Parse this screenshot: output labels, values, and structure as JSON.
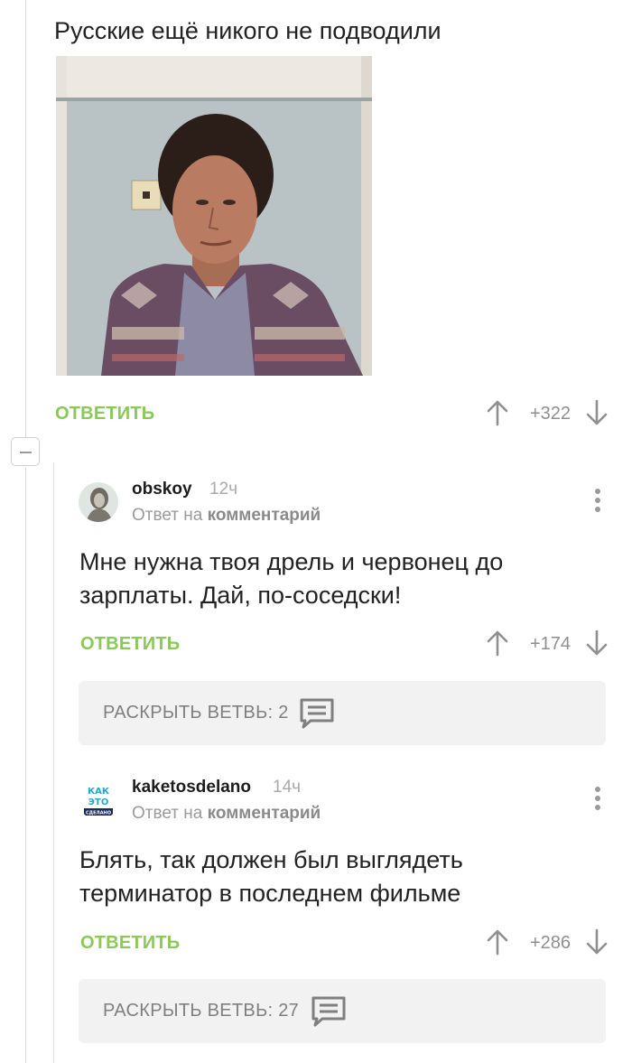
{
  "main_comment": {
    "text": "Русские ещё никого не подводили",
    "reply_label": "ОТВЕТИТЬ",
    "rating": "+322"
  },
  "comments": [
    {
      "username": "obskoy",
      "time": "12ч",
      "reply_prefix": "Ответ на",
      "reply_target": "комментарий",
      "body_lines": [
        "Мне нужна твоя дрель и червонец до",
        "зарплаты. Дай, по-соседски!"
      ],
      "reply_label": "ОТВЕТИТЬ",
      "rating": "+174",
      "expand_label": "РАСКРЫТЬ ВЕТВЬ: 2"
    },
    {
      "username": "kaketosdelano",
      "time": "14ч",
      "reply_prefix": "Ответ на",
      "reply_target": "комментарий",
      "avatar_text": [
        "КАК",
        "ЭТО",
        "СДЕЛАНО"
      ],
      "body_lines": [
        "Блять, так должен был выглядеть",
        "терминатор в последнем фильме"
      ],
      "reply_label": "ОТВЕТИТЬ",
      "rating": "+286",
      "expand_label": "РАСКРЫТЬ ВЕТВЬ: 27"
    }
  ],
  "colors": {
    "accent_green": "#8ac858",
    "rating_gray": "#8f8f8f",
    "branch_bg": "#f2f2f2"
  },
  "icons": [
    "arrow-up-icon",
    "arrow-down-icon",
    "kebab-menu-icon",
    "comments-icon",
    "minus-icon"
  ]
}
